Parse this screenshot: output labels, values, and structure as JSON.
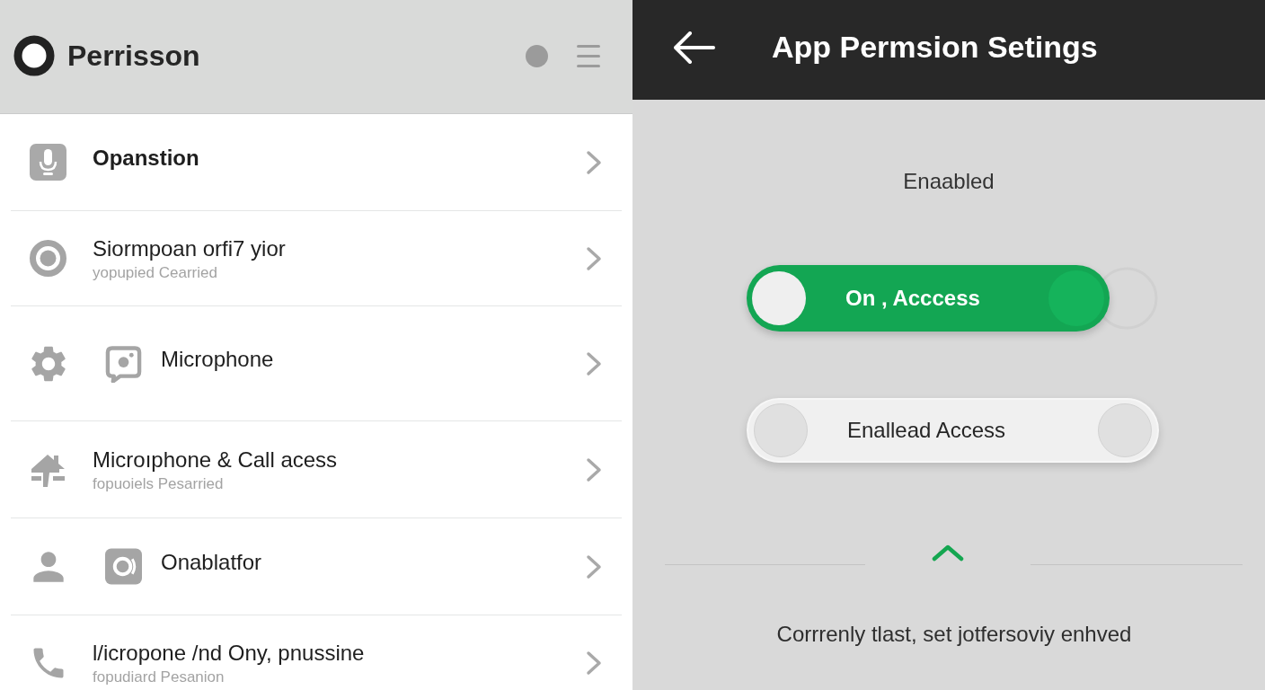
{
  "left_panel": {
    "header": {
      "title": "Perrisson"
    },
    "items": [
      {
        "title": "Opanstion",
        "emphasized": true
      },
      {
        "title": "Siormpoan orfi7 yior",
        "subtitle": "yopupied Cearried",
        "emphasized": false
      },
      {
        "title": "Microphone",
        "emphasized": false
      },
      {
        "title": "Microıphone & Call acess",
        "subtitle": "fopuoiels Pesarried",
        "emphasized": false
      },
      {
        "title": "Onablatfor",
        "emphasized": false
      },
      {
        "title": "l/icropone /nd Ony, pnussine",
        "subtitle": "fopudiard Pesanion",
        "emphasized": false
      }
    ]
  },
  "right_panel": {
    "header": {
      "title": "App Permsion Setings"
    },
    "status_label": "Enaabled",
    "toggles": [
      {
        "label": "On , Acccess",
        "on": true
      },
      {
        "label": "Enallead Access",
        "on": false
      }
    ],
    "footer_text": "Corrrenly tlast, set jotfersoviy enhved"
  }
}
